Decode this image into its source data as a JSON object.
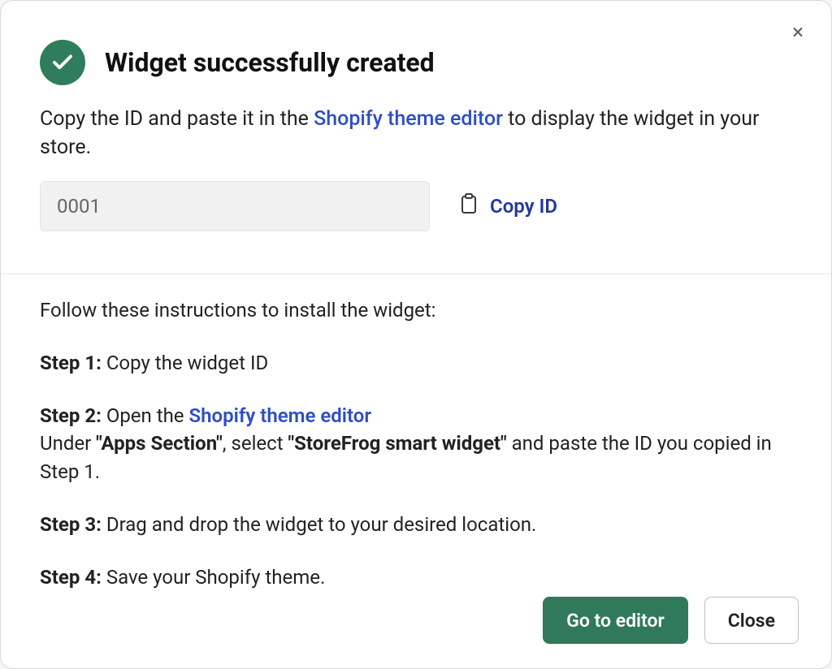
{
  "header": {
    "title": "Widget successfully created",
    "close_label": "×"
  },
  "subtitle": {
    "pre": "Copy the ID and paste it in the ",
    "link": "Shopify theme editor",
    "post": " to display the widget in your store."
  },
  "id_field": {
    "value": "0001",
    "copy_label": "Copy ID"
  },
  "instructions": {
    "intro": "Follow these instructions to install the widget:",
    "step1_label": "Step 1:",
    "step1_text": " Copy the widget ID",
    "step2_label": "Step 2:",
    "step2_pre": " Open the ",
    "step2_link": "Shopify theme editor",
    "step2_line2_pre": "Under ",
    "step2_bold1": "\"Apps Section\"",
    "step2_mid": ", select ",
    "step2_bold2": "\"StoreFrog smart widget\"",
    "step2_tail": " and paste the ID you copied in Step 1.",
    "step3_label": "Step 3:",
    "step3_text": " Drag and drop the widget to your desired location.",
    "step4_label": "Step 4:",
    "step4_text": " Save your Shopify theme."
  },
  "footer": {
    "primary": "Go to editor",
    "secondary": "Close"
  },
  "colors": {
    "accent_green": "#2f7d5d",
    "link_blue": "#2d4ec4"
  }
}
